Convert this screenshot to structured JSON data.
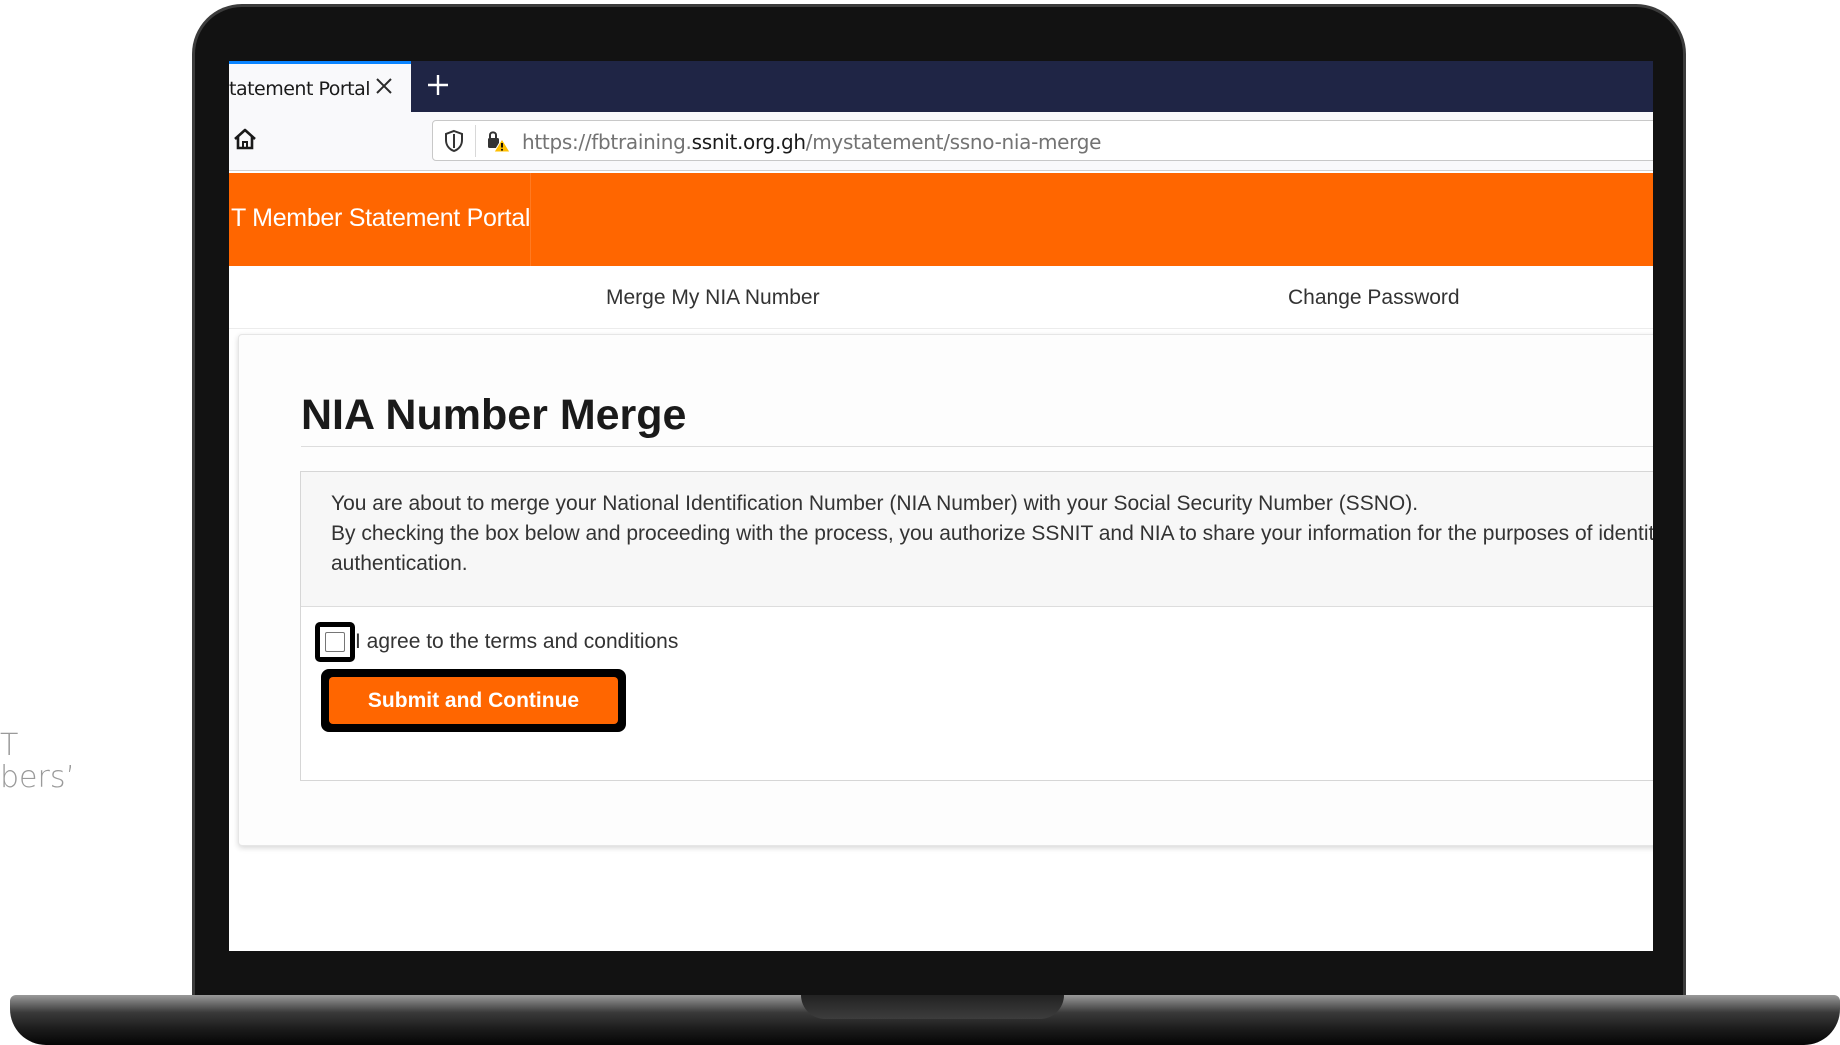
{
  "background_text": {
    "line1": "T",
    "line2": "bers’"
  },
  "browser": {
    "tab_title": "tatement Portal",
    "url": {
      "prefix": "https://fbtraining.",
      "domain": "ssnit.org.gh",
      "path": "/mystatement/ssno-nia-merge"
    }
  },
  "header": {
    "portal_title": "T Member Statement Portal"
  },
  "nav": {
    "merge_label": "Merge My NIA Number",
    "change_password_label": "Change Password"
  },
  "main": {
    "title": "NIA Number Merge",
    "info_line1": "You are about to merge your National Identification Number (NIA Number) with your Social Security Number (SSNO).",
    "info_line2": "By checking the box below and proceeding with the process, you authorize SSNIT and NIA to share your information for the purposes of identity",
    "info_line3": "authentication.",
    "agree_label": "I agree to the terms and conditions",
    "submit_label": "Submit and Continue"
  },
  "colors": {
    "brand_orange": "#ff6600",
    "tab_bar": "#1f2545",
    "highlight_border": "#000000"
  },
  "icons": [
    "close-icon",
    "plus-icon",
    "home-icon",
    "shield-icon",
    "warning-lock-icon"
  ]
}
